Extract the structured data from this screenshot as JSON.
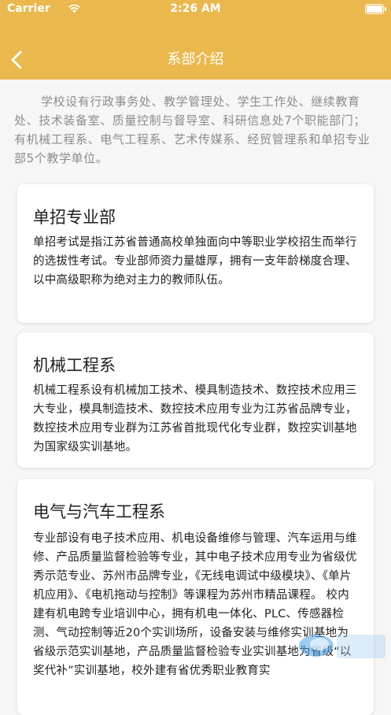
{
  "status_bar": {
    "carrier": "Carrier",
    "time": "2:26 AM"
  },
  "nav": {
    "title": "系部介绍"
  },
  "intro": "学校设有行政事务处、教学管理处、学生工作处、继续教育处、技术装备室、质量控制与督导室、科研信息处7个职能部门；有机械工程系、电气工程系、艺术传媒系、经贸管理系和单招专业部5个教学单位。",
  "departments": [
    {
      "title": "单招专业部",
      "description": "单招考试是指江苏省普通高校单独面向中等职业学校招生而举行的选拔性考试。专业部师资力量雄厚，拥有一支年龄梯度合理、以中高级职称为绝对主力的教师队伍。"
    },
    {
      "title": "机械工程系",
      "description": "机械工程系设有机械加工技术、模具制造技术、数控技术应用三大专业，模具制造技术、数控技术应用专业为江苏省品牌专业，数控技术应用专业群为江苏省首批现代化专业群，数控实训基地为国家级实训基地。"
    },
    {
      "title": "电气与汽车工程系",
      "description": "专业部设有电子技术应用、机电设备维修与管理、汽车运用与维修、产品质量监督检验等专业，其中电子技术应用专业为省级优秀示范专业、苏州市品牌专业，《无线电调试中级模块》、《单片机应用》、《电机拖动与控制》等课程为苏州市精品课程。 校内建有机电跨专业培训中心，拥有机电一体化、PLC、传感器检测、气动控制等近20个实训场所，设备安装与维修实训基地为省级示范实训基地，产品质量监督检验专业实训基地为省级“以奖代补”实训基地，校外建有省优秀职业教育实"
    }
  ],
  "colors": {
    "header": "#eab84d",
    "background": "#f6f6f6"
  },
  "icons": [
    "back-arrow-icon",
    "wifi-icon",
    "battery-icon"
  ]
}
